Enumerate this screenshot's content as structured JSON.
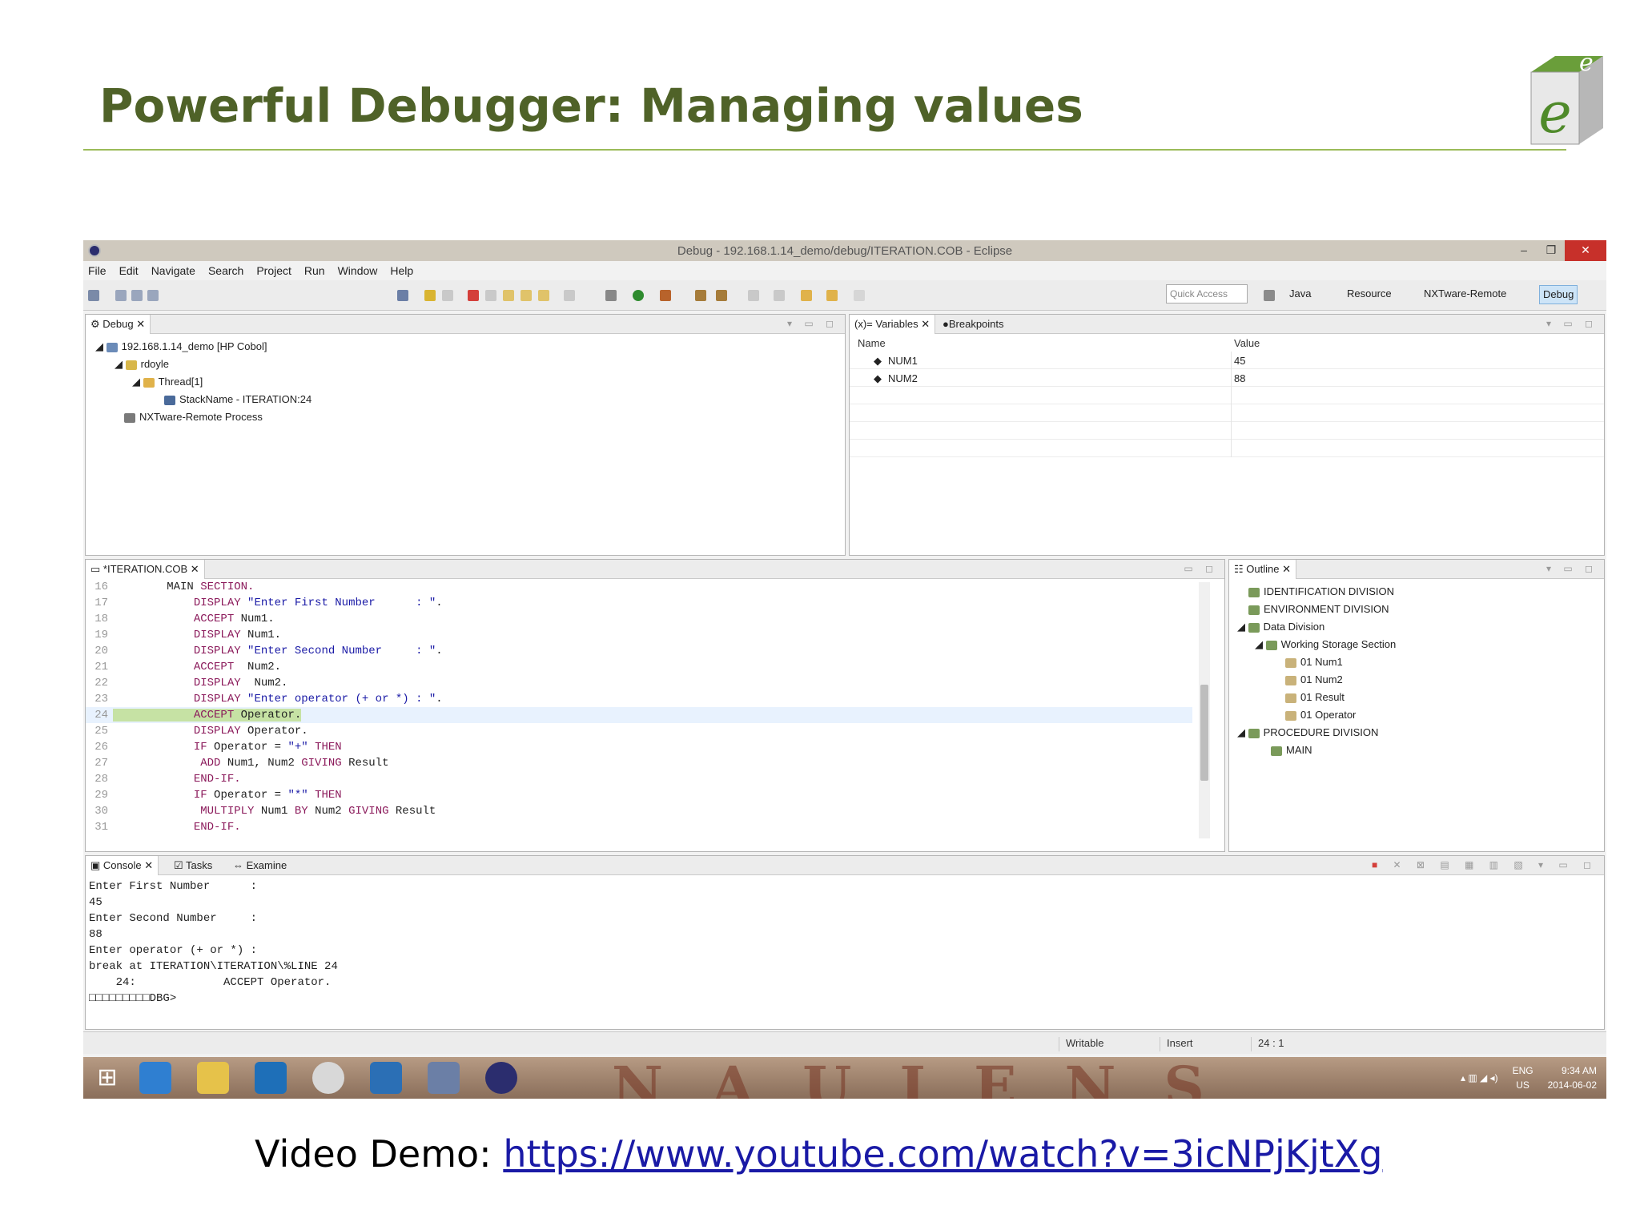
{
  "slide": {
    "title": "Powerful Debugger: Managing values",
    "video_label": "Video Demo: ",
    "video_link": "https://www.youtube.com/watch?v=3icNPjKjtXg"
  },
  "window": {
    "title": "Debug - 192.168.1.14_demo/debug/ITERATION.COB - Eclipse",
    "min": "–",
    "max": "❐",
    "close": "✕"
  },
  "menu": [
    "File",
    "Edit",
    "Navigate",
    "Search",
    "Project",
    "Run",
    "Window",
    "Help"
  ],
  "toolbar": {
    "quick_access_placeholder": "Quick Access",
    "perspectives": [
      {
        "label": "Java",
        "active": false
      },
      {
        "label": "Resource",
        "active": false
      },
      {
        "label": "NXTware-Remote",
        "active": false
      },
      {
        "label": "Debug",
        "active": true
      }
    ]
  },
  "debug_view": {
    "tab": "Debug",
    "tree": [
      {
        "label": "192.168.1.14_demo [HP Cobol]",
        "level": 0
      },
      {
        "label": "rdoyle",
        "level": 1
      },
      {
        "label": "Thread[1]",
        "level": 2
      },
      {
        "label": "StackName - ITERATION:24",
        "level": 3
      },
      {
        "label": "NXTware-Remote Process",
        "level": 1
      }
    ]
  },
  "variables_view": {
    "tabs": [
      "Variables",
      "Breakpoints"
    ],
    "col_name": "Name",
    "col_value": "Value",
    "rows": [
      {
        "name": "NUM1",
        "value": "45"
      },
      {
        "name": "NUM2",
        "value": "88"
      }
    ]
  },
  "editor": {
    "tab": "*ITERATION.COB",
    "lines": [
      {
        "n": "16",
        "text": "MAIN SECTION."
      },
      {
        "n": "17",
        "text": "DISPLAY \"Enter First Number      : \"."
      },
      {
        "n": "18",
        "text": "ACCEPT Num1."
      },
      {
        "n": "19",
        "text": "DISPLAY Num1."
      },
      {
        "n": "20",
        "text": "DISPLAY \"Enter Second Number     : \"."
      },
      {
        "n": "21",
        "text": "ACCEPT  Num2."
      },
      {
        "n": "22",
        "text": "DISPLAY  Num2."
      },
      {
        "n": "23",
        "text": "DISPLAY \"Enter operator (+ or *) : \"."
      },
      {
        "n": "24",
        "text": "ACCEPT Operator."
      },
      {
        "n": "25",
        "text": "DISPLAY Operator."
      },
      {
        "n": "26",
        "text": "IF Operator = \"+\" THEN"
      },
      {
        "n": "27",
        "text": " ADD Num1, Num2 GIVING Result"
      },
      {
        "n": "28",
        "text": "END-IF."
      },
      {
        "n": "29",
        "text": "IF Operator = \"*\" THEN"
      },
      {
        "n": "30",
        "text": " MULTIPLY Num1 BY Num2 GIVING Result"
      },
      {
        "n": "31",
        "text": "END-IF."
      }
    ]
  },
  "outline_view": {
    "tab": "Outline",
    "tree": [
      {
        "label": "IDENTIFICATION DIVISION",
        "level": 0
      },
      {
        "label": "ENVIRONMENT DIVISION",
        "level": 0
      },
      {
        "label": "Data Division",
        "level": 0
      },
      {
        "label": "Working Storage Section",
        "level": 1
      },
      {
        "label": "01 Num1",
        "level": 2
      },
      {
        "label": "01 Num2",
        "level": 2
      },
      {
        "label": "01 Result",
        "level": 2
      },
      {
        "label": "01 Operator",
        "level": 2
      },
      {
        "label": "PROCEDURE DIVISION",
        "level": 0
      },
      {
        "label": "MAIN",
        "level": 1
      }
    ]
  },
  "console_view": {
    "tabs": [
      "Console",
      "Tasks",
      "Examine"
    ],
    "lines": [
      "Enter First Number      :",
      "45",
      "Enter Second Number     :",
      "88",
      "Enter operator (+ or *) :",
      "break at ITERATION\\ITERATION\\%LINE 24",
      "    24:             ACCEPT Operator.",
      "□□□□□□□□□DBG>"
    ]
  },
  "status": {
    "writable": "Writable",
    "insert": "Insert",
    "position": "24 : 1"
  },
  "taskbar": {
    "lang": "ENG",
    "region": "US",
    "time": "9:34 AM",
    "date": "2014-06-02"
  },
  "colors": {
    "title_green": "#4f6228",
    "rule_green": "#9bbb59",
    "keyword": "#8b1a5b",
    "string": "#1a1aa6",
    "current_line": "#c6e2a4"
  }
}
